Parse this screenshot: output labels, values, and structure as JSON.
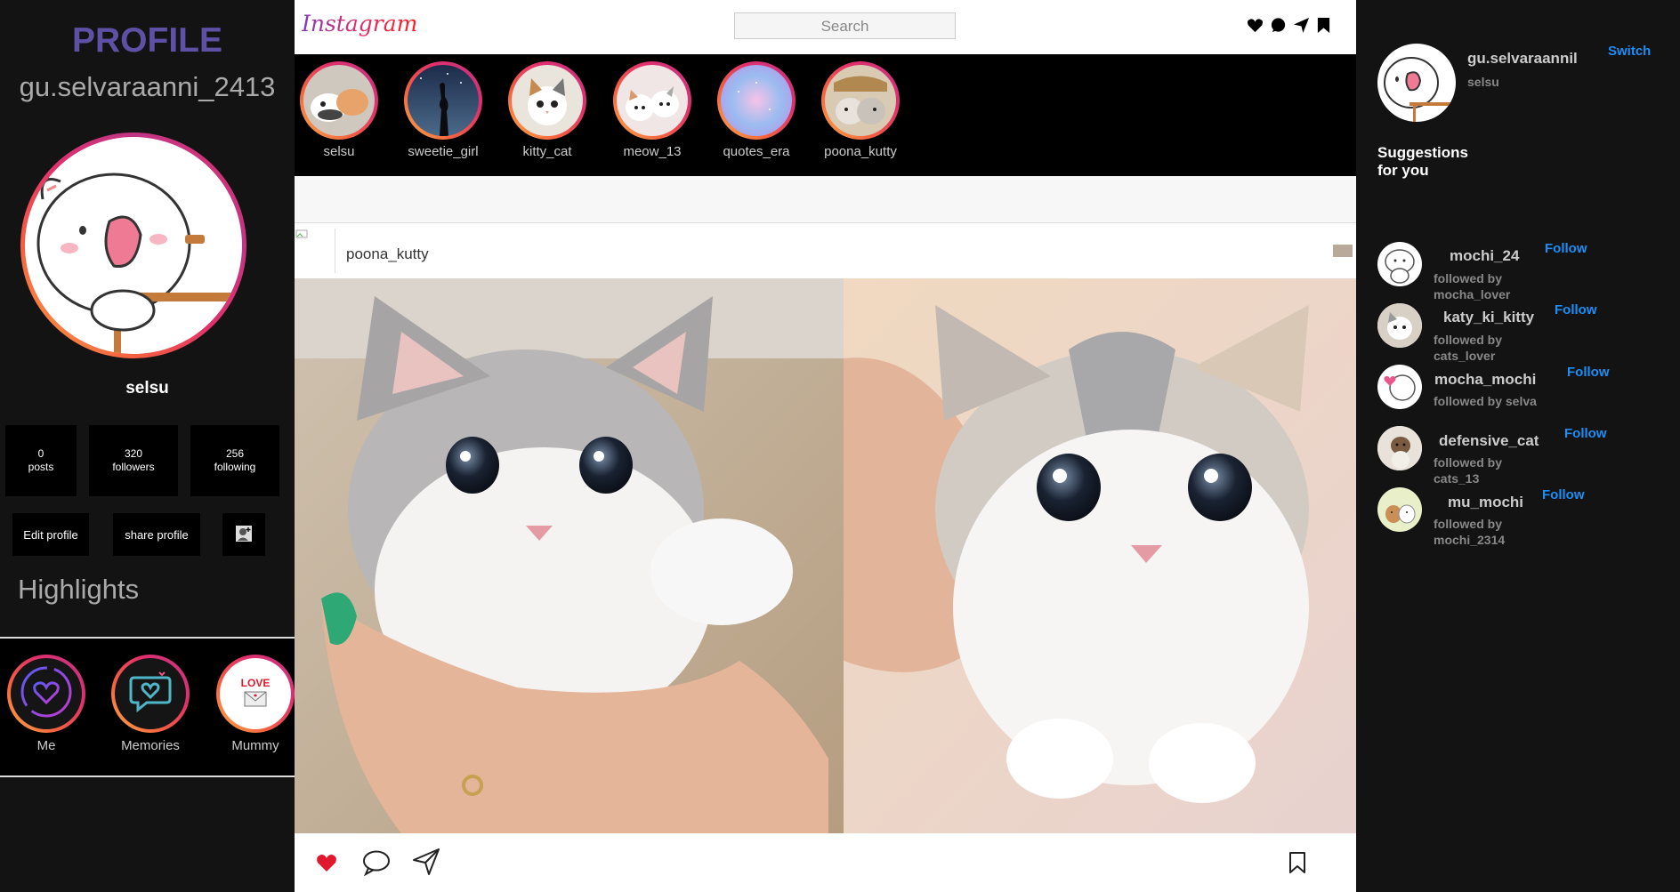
{
  "profile": {
    "heading": "PROFILE",
    "username": "gu.selvaraanni_2413",
    "display_name": "selsu",
    "avatar_icon": "cartoon-cat-avatar",
    "stats": [
      {
        "value": "0",
        "label": "posts"
      },
      {
        "value": "320",
        "label": "followers"
      },
      {
        "value": "256",
        "label": "following"
      }
    ],
    "actions": {
      "edit": "Edit profile",
      "share": "share profile",
      "add_user_icon": "add-user-icon"
    },
    "highlights_title": "Highlights",
    "highlights": [
      {
        "label": "Me",
        "icon": "heart-circle-icon"
      },
      {
        "label": "Memories",
        "icon": "chat-heart-icon"
      },
      {
        "label": "Mummy",
        "icon": "love-letter-icon"
      }
    ]
  },
  "topbar": {
    "logo": "Instagram",
    "search_placeholder": "Search",
    "icons": [
      "heart-icon",
      "message-icon",
      "send-icon",
      "bookmark-icon"
    ]
  },
  "stories": [
    {
      "name": "selsu"
    },
    {
      "name": "sweetie_girl"
    },
    {
      "name": "kitty_cat"
    },
    {
      "name": "meow_13"
    },
    {
      "name": "quotes_era"
    },
    {
      "name": "poona_kutty"
    }
  ],
  "post": {
    "username": "poona_kutty",
    "image_desc_icon": "kitten-photo",
    "actions": [
      "like-icon",
      "comment-icon",
      "share-icon",
      "save-icon"
    ]
  },
  "right": {
    "username": "gu.selvaraannil",
    "name": "selsu",
    "switch_label": "Switch",
    "suggestions_title": "Suggestions for you",
    "suggestions": [
      {
        "name": "mochi_24",
        "followed_by": "followed by mocha_lover",
        "follow": "Follow"
      },
      {
        "name": "katy_ki_kitty",
        "followed_by": "followed by cats_lover",
        "follow": "Follow"
      },
      {
        "name": "mocha_mochi",
        "followed_by": "followed by selva",
        "follow": "Follow"
      },
      {
        "name": "defensive_cat",
        "followed_by": "followed by cats_13",
        "follow": "Follow"
      },
      {
        "name": "mu_mochi",
        "followed_by": "followed by mochi_2314",
        "follow": "Follow"
      }
    ]
  },
  "colors": {
    "profile_heading": "#5d50a5",
    "link_blue": "#1c8ef5",
    "like_red": "#e0182d",
    "sidebar_bg": "#131313"
  }
}
